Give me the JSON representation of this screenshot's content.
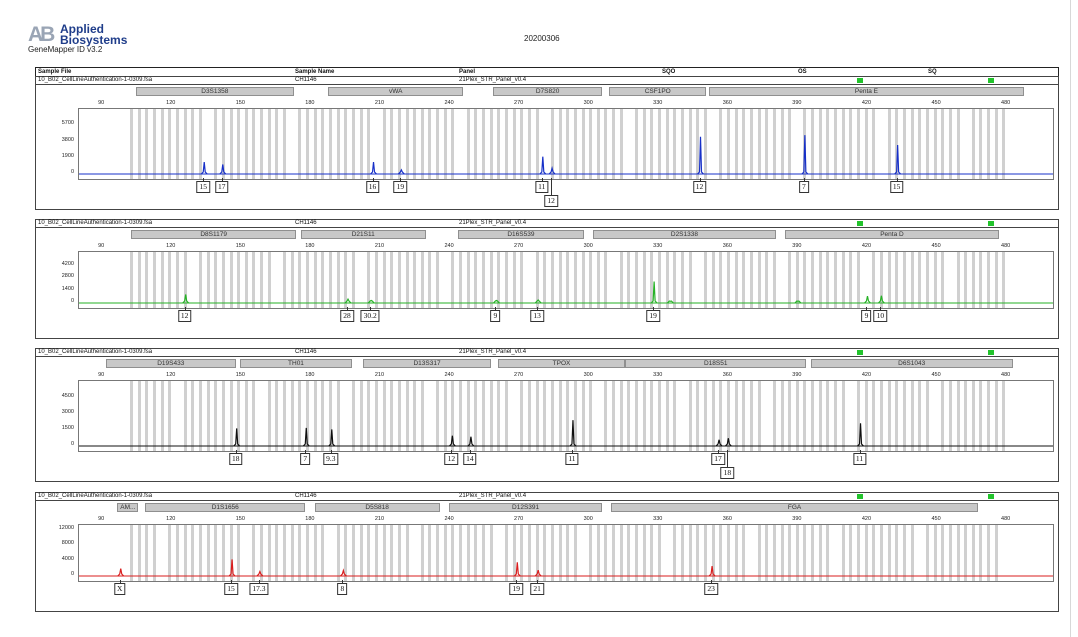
{
  "header": {
    "logo_mark": "AB",
    "brand_line1": "Applied",
    "brand_line2": "Biosystems",
    "app_name": "GeneMapper ID v3.2",
    "report_date": "20200306"
  },
  "columns": {
    "sample_file": "Sample File",
    "sample_name": "Sample Name",
    "panel": "Panel",
    "sqo": "SQO",
    "os": "OS",
    "sq": "SQ"
  },
  "colors": {
    "blue": "#1730c8",
    "green": "#26b226",
    "black": "#101010",
    "red": "#d91e1e",
    "quality_ok": "#22c32c",
    "bin": "#d0d0d0",
    "locus": "#c8c8c8"
  },
  "x_ticks": [
    90,
    120,
    150,
    180,
    210,
    240,
    270,
    300,
    330,
    360,
    390,
    420,
    450,
    480
  ],
  "x_range": [
    80,
    500
  ],
  "panels": [
    {
      "sample_file": "10_B02_CellLineAuthentication-1-0309.fsa",
      "sample_name": "CH1146",
      "panel_name": "21Plex_STR_Panel_v0.4",
      "color": "#1730c8",
      "y_ticks": [
        "5700",
        "3800",
        "1900",
        "0"
      ],
      "y_max": 7500,
      "loci": [
        {
          "name": "D3S1358",
          "start": 105,
          "end": 173
        },
        {
          "name": "vWA",
          "start": 188,
          "end": 246
        },
        {
          "name": "D7S820",
          "start": 259,
          "end": 306
        },
        {
          "name": "CSF1PO",
          "start": 309,
          "end": 351
        },
        {
          "name": "Penta E",
          "start": 352,
          "end": 488
        }
      ],
      "peaks": [
        {
          "size": 134,
          "height": 1450
        },
        {
          "size": 142,
          "height": 1150
        },
        {
          "size": 207,
          "height": 1450
        },
        {
          "size": 219,
          "height": 500
        },
        {
          "size": 280,
          "height": 2100
        },
        {
          "size": 284,
          "height": 700
        },
        {
          "size": 348,
          "height": 4500
        },
        {
          "size": 393,
          "height": 4700
        },
        {
          "size": 433,
          "height": 3500
        }
      ],
      "alleles": [
        {
          "label": "15",
          "size": 134,
          "row": 0
        },
        {
          "label": "17",
          "size": 142,
          "row": 0
        },
        {
          "label": "16",
          "size": 207,
          "row": 0
        },
        {
          "label": "19",
          "size": 219,
          "row": 0
        },
        {
          "label": "11",
          "size": 280,
          "row": 0
        },
        {
          "label": "12",
          "size": 284,
          "row": 1
        },
        {
          "label": "12",
          "size": 348,
          "row": 0
        },
        {
          "label": "7",
          "size": 393,
          "row": 0
        },
        {
          "label": "15",
          "size": 433,
          "row": 0
        }
      ]
    },
    {
      "sample_file": "10_B02_CellLineAuthentication-1-0309.fsa",
      "sample_name": "CH1146",
      "panel_name": "21Plex_STR_Panel_v0.4",
      "color": "#26b226",
      "y_ticks": [
        "4200",
        "2800",
        "1400",
        "0"
      ],
      "y_max": 5600,
      "loci": [
        {
          "name": "D8S1179",
          "start": 103,
          "end": 174
        },
        {
          "name": "D21S11",
          "start": 176,
          "end": 230
        },
        {
          "name": "D16S539",
          "start": 244,
          "end": 298
        },
        {
          "name": "D2S1338",
          "start": 302,
          "end": 381
        },
        {
          "name": "Penta D",
          "start": 385,
          "end": 477
        }
      ],
      "peaks": [
        {
          "size": 126,
          "height": 1000
        },
        {
          "size": 196,
          "height": 450
        },
        {
          "size": 206,
          "height": 300
        },
        {
          "size": 260,
          "height": 300
        },
        {
          "size": 278,
          "height": 350
        },
        {
          "size": 328,
          "height": 2500
        },
        {
          "size": 335,
          "height": 200
        },
        {
          "size": 390,
          "height": 200
        },
        {
          "size": 420,
          "height": 800
        },
        {
          "size": 426,
          "height": 850
        }
      ],
      "alleles": [
        {
          "label": "12",
          "size": 126,
          "row": 0
        },
        {
          "label": "28",
          "size": 196,
          "row": 0
        },
        {
          "label": "30.2",
          "size": 206,
          "row": 0
        },
        {
          "label": "9",
          "size": 260,
          "row": 0
        },
        {
          "label": "13",
          "size": 278,
          "row": 0
        },
        {
          "label": "19",
          "size": 328,
          "row": 0
        },
        {
          "label": "9",
          "size": 420,
          "row": 0
        },
        {
          "label": "10",
          "size": 426,
          "row": 0
        }
      ]
    },
    {
      "sample_file": "10_B02_CellLineAuthentication-1-0309.fsa",
      "sample_name": "CH1146",
      "panel_name": "21Plex_STR_Panel_v0.4",
      "color": "#101010",
      "y_ticks": [
        "4500",
        "3000",
        "1500",
        "0"
      ],
      "y_max": 6000,
      "loci": [
        {
          "name": "D19S433",
          "start": 92,
          "end": 148
        },
        {
          "name": "TH01",
          "start": 150,
          "end": 198
        },
        {
          "name": "D13S317",
          "start": 203,
          "end": 258
        },
        {
          "name": "TPOX",
          "start": 261,
          "end": 316
        },
        {
          "name": "D18S51",
          "start": 316,
          "end": 394
        },
        {
          "name": "D6S1043",
          "start": 396,
          "end": 483
        }
      ],
      "peaks": [
        {
          "size": 148,
          "height": 1700
        },
        {
          "size": 178,
          "height": 1750
        },
        {
          "size": 189,
          "height": 1600
        },
        {
          "size": 241,
          "height": 1000
        },
        {
          "size": 249,
          "height": 900
        },
        {
          "size": 293,
          "height": 2500
        },
        {
          "size": 356,
          "height": 600
        },
        {
          "size": 360,
          "height": 750
        },
        {
          "size": 417,
          "height": 2200
        }
      ],
      "alleles": [
        {
          "label": "18",
          "size": 148,
          "row": 0
        },
        {
          "label": "7",
          "size": 178,
          "row": 0
        },
        {
          "label": "9.3",
          "size": 189,
          "row": 0
        },
        {
          "label": "12",
          "size": 241,
          "row": 0
        },
        {
          "label": "14",
          "size": 249,
          "row": 0
        },
        {
          "label": "11",
          "size": 293,
          "row": 0
        },
        {
          "label": "17",
          "size": 356,
          "row": 0
        },
        {
          "label": "18",
          "size": 360,
          "row": 1
        },
        {
          "label": "11",
          "size": 417,
          "row": 0
        }
      ]
    },
    {
      "sample_file": "10_B02_CellLineAuthentication-1-0309.fsa",
      "sample_name": "CH1146",
      "panel_name": "21Plex_STR_Panel_v0.4",
      "color": "#d91e1e",
      "y_ticks": [
        "12000",
        "8000",
        "4000",
        "0"
      ],
      "y_max": 13000,
      "loci": [
        {
          "name": "AM...",
          "start": 97,
          "end": 106
        },
        {
          "name": "D1S1656",
          "start": 109,
          "end": 178
        },
        {
          "name": "D5S818",
          "start": 182,
          "end": 236
        },
        {
          "name": "D12S391",
          "start": 240,
          "end": 306
        },
        {
          "name": "FGA",
          "start": 310,
          "end": 468
        }
      ],
      "peaks": [
        {
          "size": 98,
          "height": 2000
        },
        {
          "size": 146,
          "height": 4500
        },
        {
          "size": 158,
          "height": 1200
        },
        {
          "size": 194,
          "height": 1500
        },
        {
          "size": 269,
          "height": 3700
        },
        {
          "size": 278,
          "height": 1600
        },
        {
          "size": 353,
          "height": 2700
        }
      ],
      "alleles": [
        {
          "label": "X",
          "size": 98,
          "row": 0
        },
        {
          "label": "15",
          "size": 146,
          "row": 0
        },
        {
          "label": "17.3",
          "size": 158,
          "row": 0
        },
        {
          "label": "8",
          "size": 194,
          "row": 0
        },
        {
          "label": "19",
          "size": 269,
          "row": 0
        },
        {
          "label": "21",
          "size": 278,
          "row": 0
        },
        {
          "label": "23",
          "size": 353,
          "row": 0
        }
      ]
    }
  ]
}
